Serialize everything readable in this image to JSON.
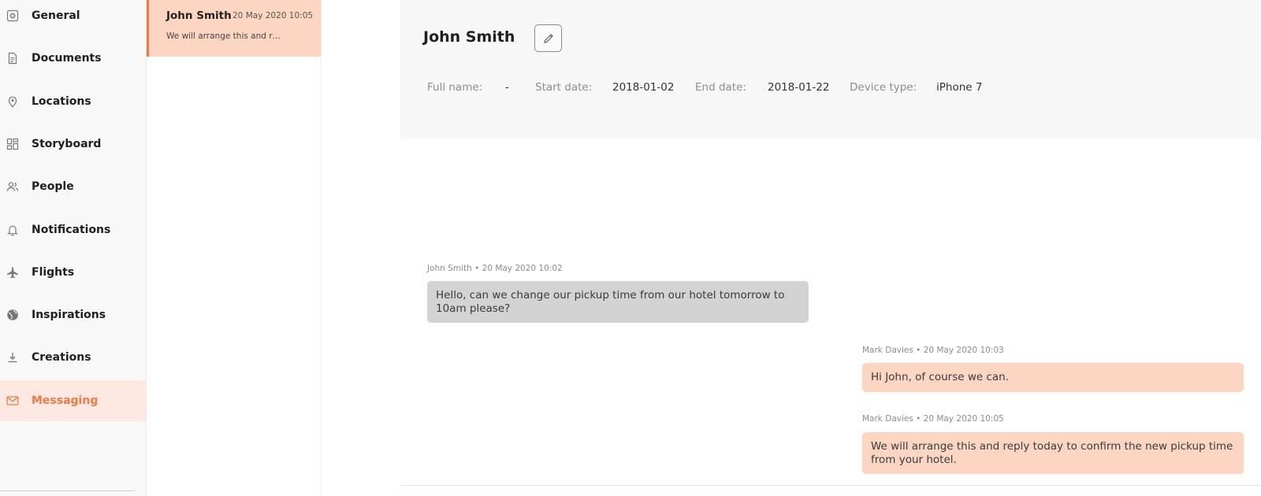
{
  "sidebar": {
    "items": [
      {
        "label": "General",
        "icon": "gear-icon"
      },
      {
        "label": "Documents",
        "icon": "document-icon"
      },
      {
        "label": "Locations",
        "icon": "location-pin-icon"
      },
      {
        "label": "Storyboard",
        "icon": "dashboard-grid-icon"
      },
      {
        "label": "People",
        "icon": "people-icon"
      },
      {
        "label": "Notifications",
        "icon": "bell-icon"
      },
      {
        "label": "Flights",
        "icon": "airplane-icon"
      },
      {
        "label": "Inspirations",
        "icon": "globe-icon"
      },
      {
        "label": "Creations",
        "icon": "download-icon"
      },
      {
        "label": "Messaging",
        "icon": "envelope-icon",
        "active": true
      }
    ]
  },
  "conversations": [
    {
      "name": "John Smith",
      "time": "20 May 2020 10:05",
      "preview": "We will arrange this and re..."
    }
  ],
  "header": {
    "title": "John Smith",
    "edit_icon": "pencil-icon",
    "fields": {
      "full_name_label": "Full name:",
      "full_name_value": "-",
      "start_date_label": "Start date:",
      "start_date_value": "2018-01-02",
      "end_date_label": "End date:",
      "end_date_value": "2018-01-22",
      "device_type_label": "Device type:",
      "device_type_value": "iPhone 7"
    }
  },
  "messages": [
    {
      "meta": "John Smith • 20 May 2020 10:02",
      "text": "Hello, can we change our pickup time from our hotel tomorrow to 10am please?",
      "direction": "incoming"
    },
    {
      "meta": "Mark Davies • 20 May 2020 10:03",
      "text": "Hi John, of course we can.",
      "direction": "outgoing"
    },
    {
      "meta": "Mark Davies • 20 May 2020 10:05",
      "text": "We will arrange this and reply today to confirm the new pickup time from your hotel.",
      "direction": "outgoing"
    }
  ],
  "colors": {
    "accent": "#f07a45",
    "accent_light": "#fde9e1",
    "outgoing_bubble": "#fdd5c3",
    "incoming_bubble": "#d3d3d4"
  }
}
